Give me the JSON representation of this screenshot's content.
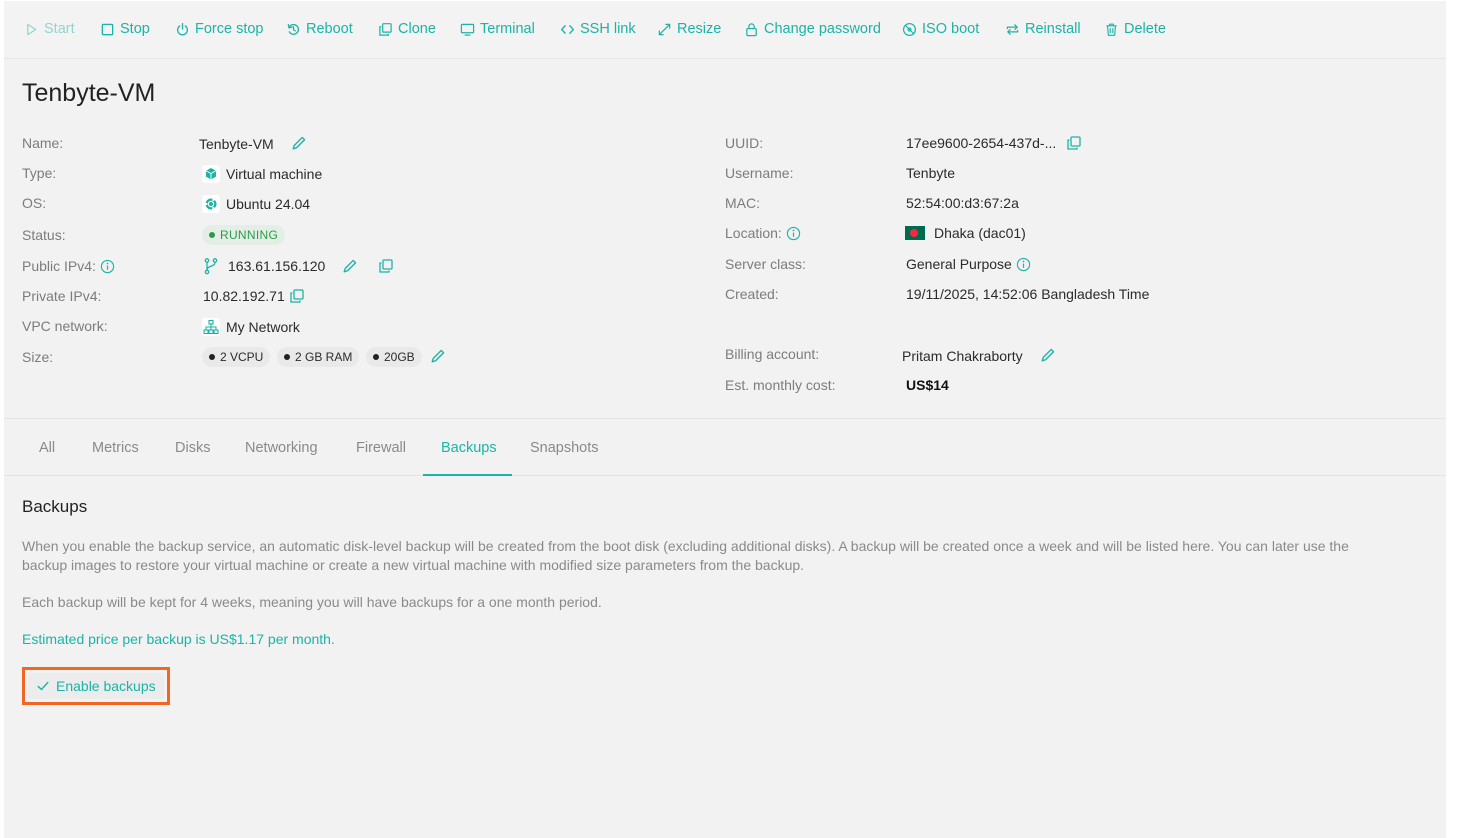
{
  "toolbar": {
    "start": "Start",
    "stop": "Stop",
    "force_stop": "Force stop",
    "reboot": "Reboot",
    "clone": "Clone",
    "terminal": "Terminal",
    "ssh_link": "SSH link",
    "resize": "Resize",
    "change_password": "Change password",
    "iso_boot": "ISO boot",
    "reinstall": "Reinstall",
    "delete": "Delete"
  },
  "vm": {
    "title": "Tenbyte-VM",
    "left": {
      "name_label": "Name:",
      "name": "Tenbyte-VM",
      "type_label": "Type:",
      "type": "Virtual machine",
      "os_label": "OS:",
      "os": "Ubuntu 24.04",
      "status_label": "Status:",
      "status": "RUNNING",
      "public_ipv4_label": "Public IPv4:",
      "public_ipv4": "163.61.156.120",
      "private_ipv4_label": "Private IPv4:",
      "private_ipv4": "10.82.192.71",
      "vpc_label": "VPC network:",
      "vpc": "My Network",
      "size_label": "Size:",
      "size_chips": [
        "2 VCPU",
        "2 GB RAM",
        "20GB"
      ]
    },
    "right": {
      "uuid_label": "UUID:",
      "uuid": "17ee9600-2654-437d-...",
      "username_label": "Username:",
      "username": "Tenbyte",
      "mac_label": "MAC:",
      "mac": "52:54:00:d3:67:2a",
      "location_label": "Location:",
      "location": "Dhaka (dac01)",
      "server_class_label": "Server class:",
      "server_class": "General Purpose",
      "created_label": "Created:",
      "created": "19/11/2025, 14:52:06 Bangladesh Time",
      "billing_label": "Billing account:",
      "billing": "Pritam Chakraborty",
      "cost_label": "Est. monthly cost:",
      "cost": "US$14"
    }
  },
  "tabs": [
    "All",
    "Metrics",
    "Disks",
    "Networking",
    "Firewall",
    "Backups",
    "Snapshots"
  ],
  "active_tab": "Backups",
  "backups": {
    "title": "Backups",
    "para1_line1": "When you enable the backup service, an automatic disk-level backup will be created from the boot disk (excluding additional disks). A backup will be created once a week and will be listed here. You can later use the",
    "para1_line2": "backup images to restore your virtual machine or create a new virtual machine with modified size parameters from the backup.",
    "para2": "Each backup will be kept for 4 weeks, meaning you will have backups for a one month period.",
    "price_note": "Estimated price per backup is US$1.17 per month.",
    "enable_button": "Enable backups"
  },
  "colors": {
    "accent": "#1bb4a6",
    "running": "#2a9b4a",
    "highlight": "#f26522"
  }
}
